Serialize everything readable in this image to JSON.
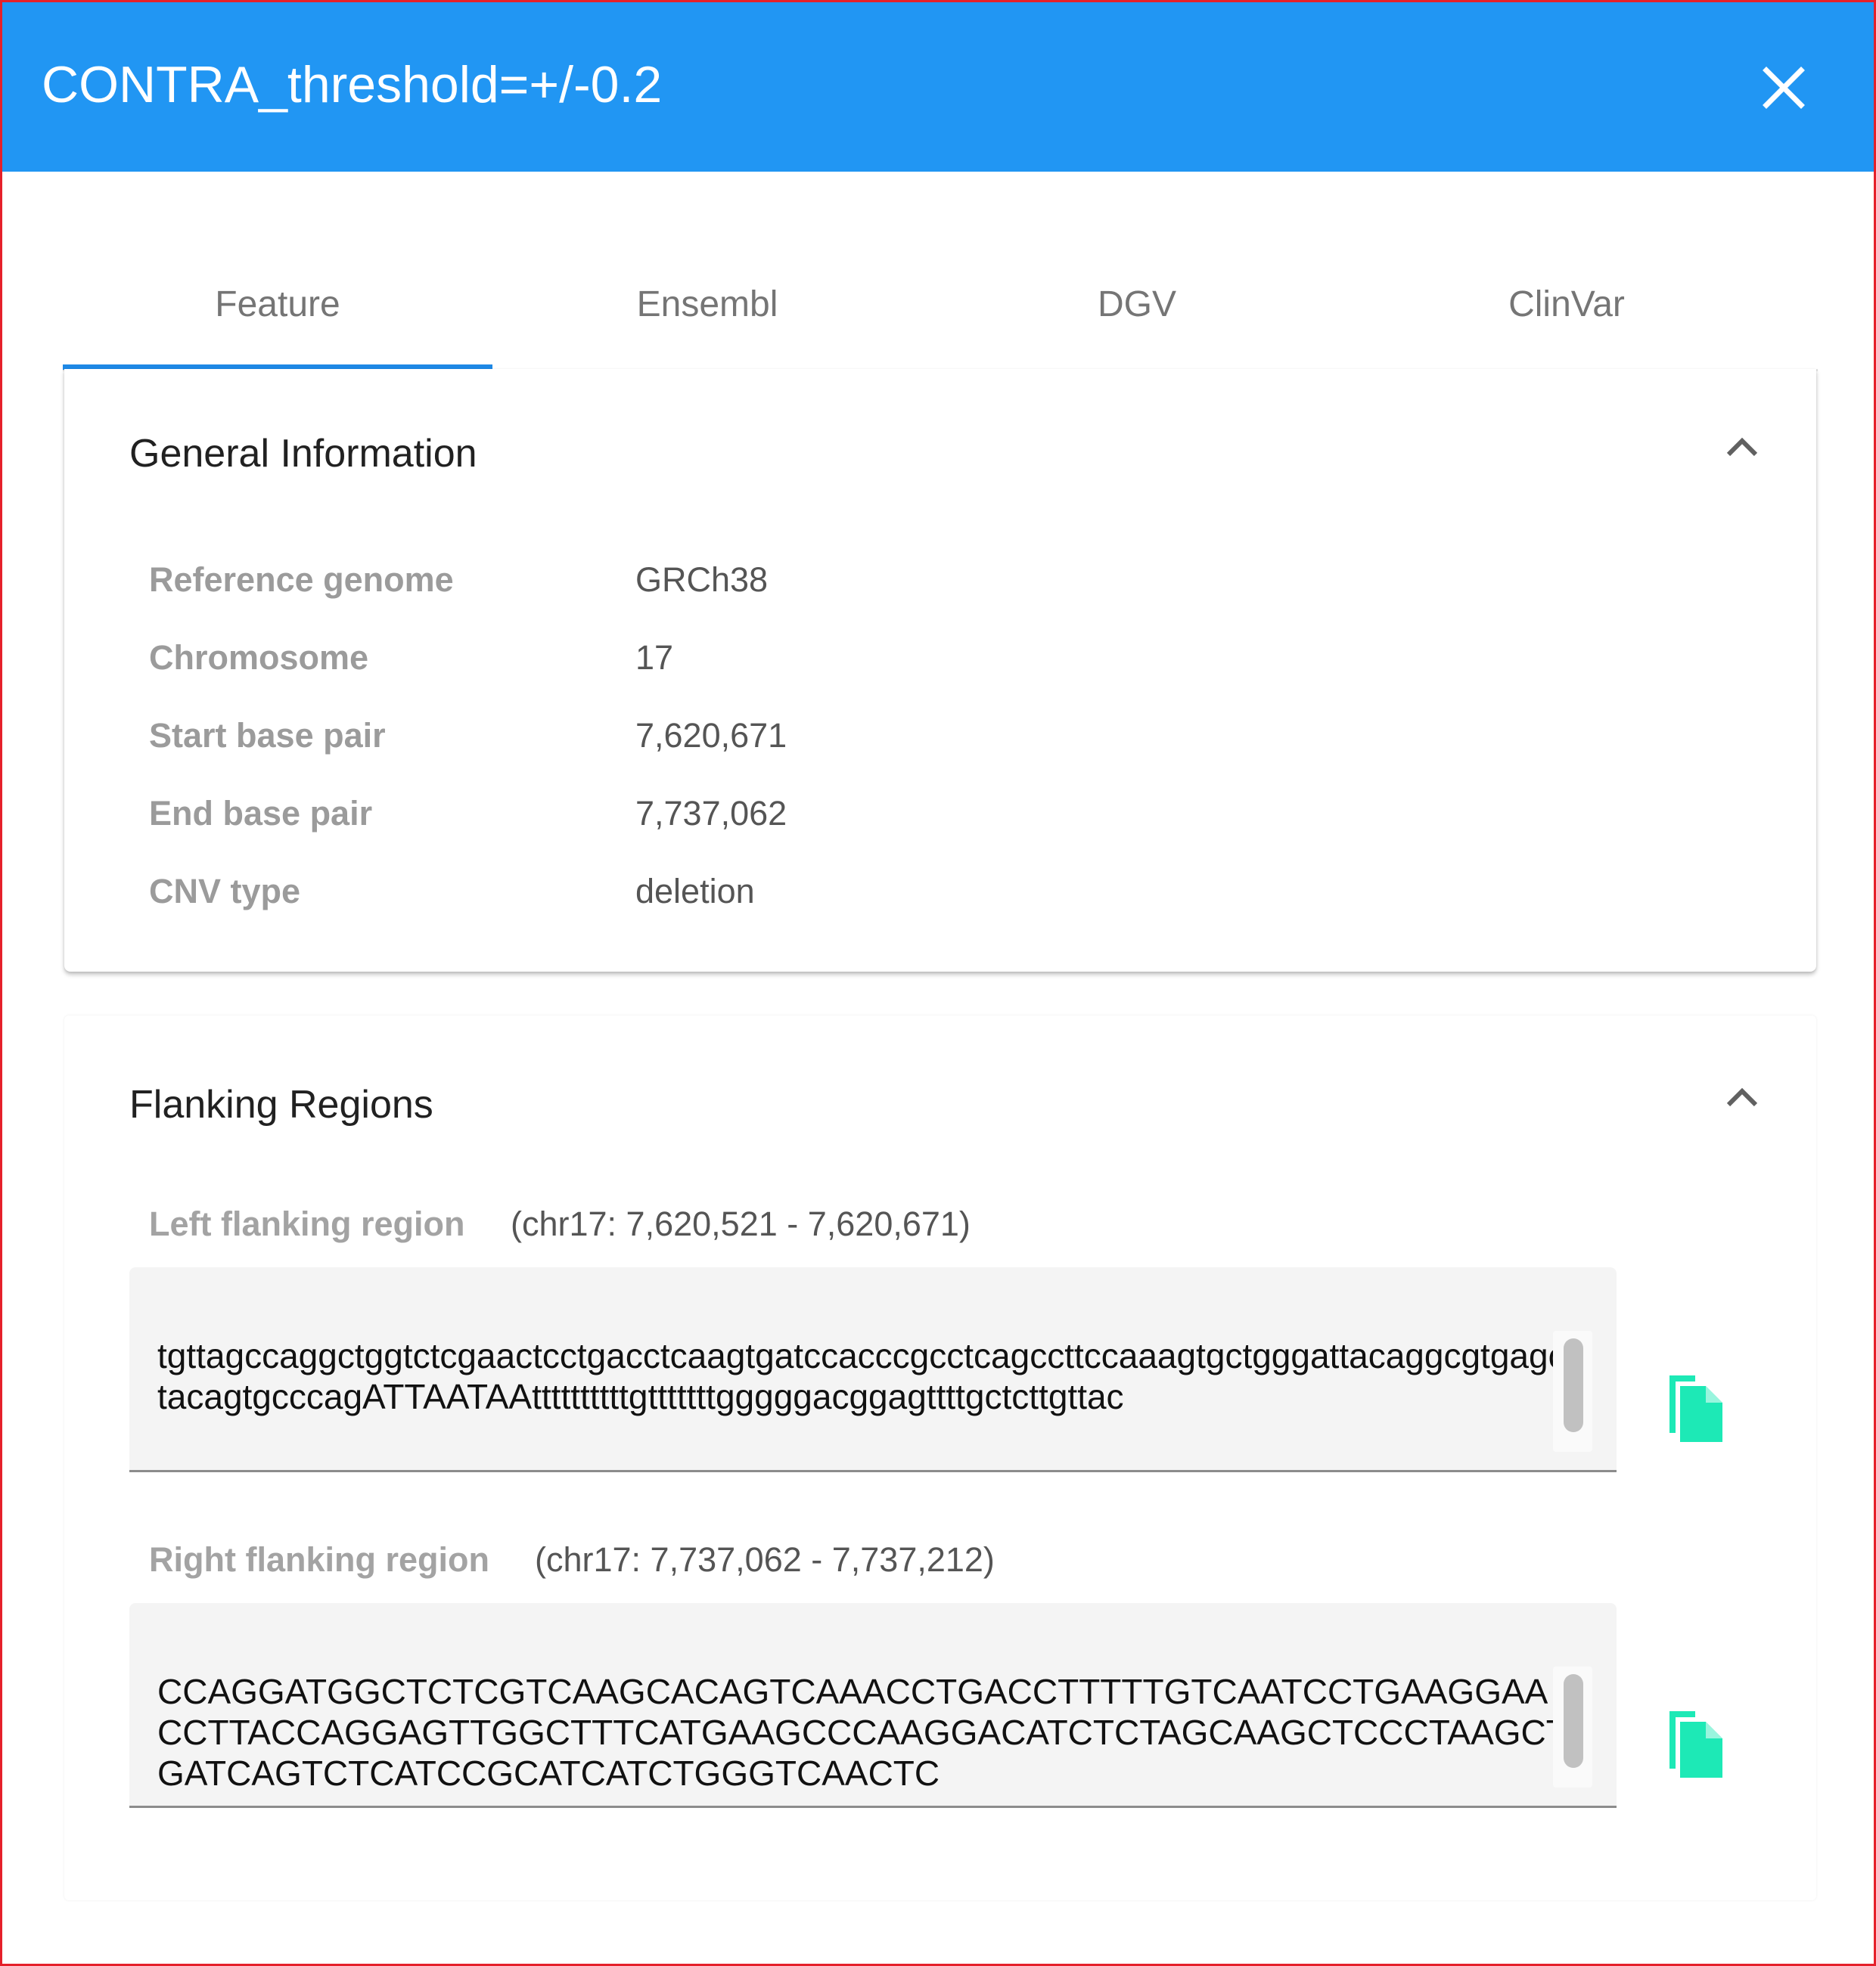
{
  "dialog": {
    "title": "CONTRA_threshold=+/-0.2"
  },
  "tabs": [
    {
      "label": "Feature",
      "active": true
    },
    {
      "label": "Ensembl",
      "active": false
    },
    {
      "label": "DGV",
      "active": false
    },
    {
      "label": "ClinVar",
      "active": false
    }
  ],
  "general": {
    "title": "General Information",
    "rows": [
      {
        "label": "Reference genome",
        "value": "GRCh38"
      },
      {
        "label": "Chromosome",
        "value": "17"
      },
      {
        "label": "Start base pair",
        "value": "7,620,671"
      },
      {
        "label": "End base pair",
        "value": "7,737,062"
      },
      {
        "label": "CNV type",
        "value": "deletion"
      }
    ]
  },
  "flanking": {
    "title": "Flanking Regions",
    "left": {
      "label": "Left flanking region",
      "coords": "(chr17: 7,620,521 - 7,620,671)",
      "sequence": "tgttagccaggctggtctcgaactcctgacctcaagtgatccacccgcctcagccttccaaagtgctgggattacaggcgtgagctacagtgcccagATTAATAAttttttttttgtttttttgggggacggagttttgctcttgttac"
    },
    "right": {
      "label": "Right flanking region",
      "coords": "(chr17: 7,737,062 - 7,737,212)",
      "sequence": "CCAGGATGGCTCTCGTCAAGCACAGTCAAACCTGACCTTTTTGTCAATCCTGAAGGAACCTTACCAGGAGTTGGCTTTCATGAAGCCCAAGGACATCTCTAGCAAGCTCCCTAAGCTGATCAGTCTCATCCGCATCATCTGGGTCAACTC"
    }
  },
  "icons": {
    "close": "close-icon",
    "collapse": "chevron-up-icon",
    "copy": "copy-icon"
  },
  "colors": {
    "header": "#2196f3",
    "tab_indicator": "#1e88e5",
    "copy_icon": "#1de9b6",
    "frame_border": "#e5202a"
  }
}
